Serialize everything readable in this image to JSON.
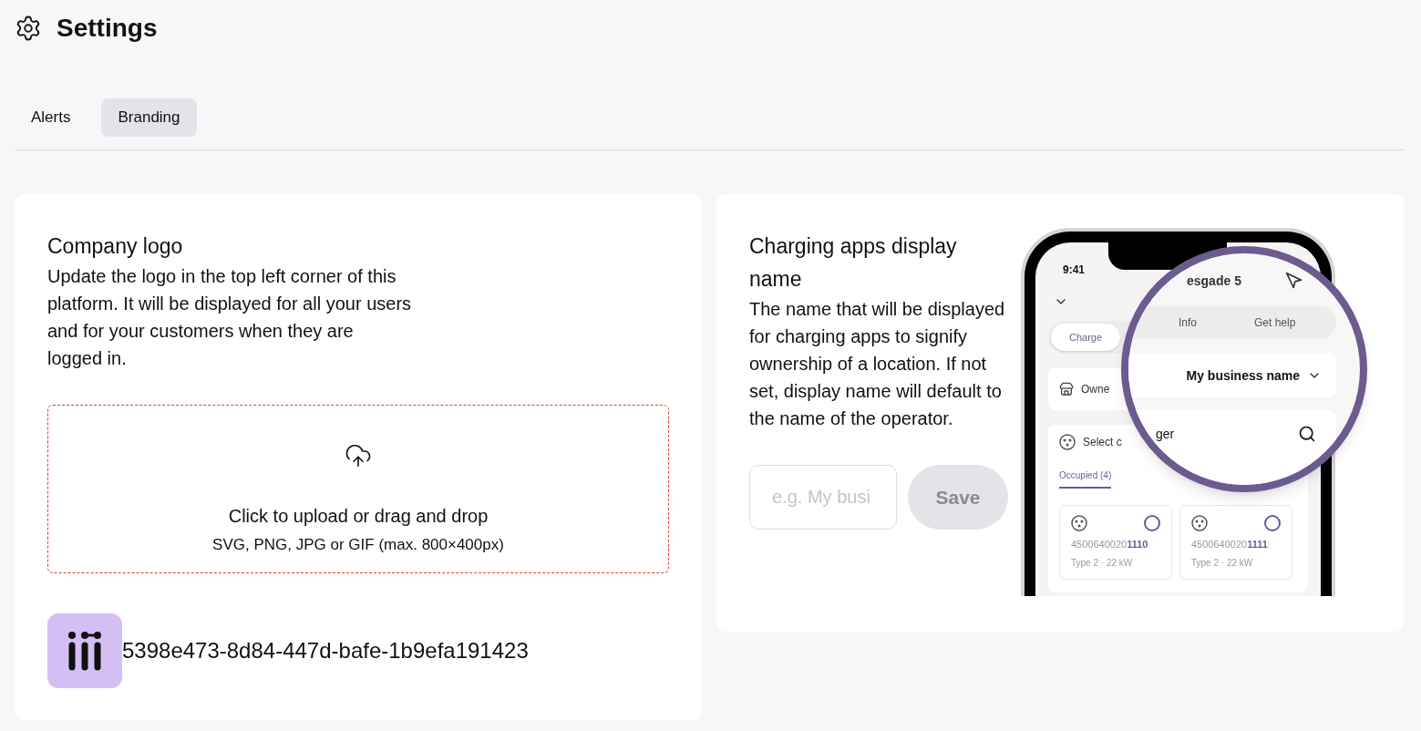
{
  "header": {
    "title": "Settings"
  },
  "tabs": [
    {
      "label": "Alerts",
      "selected": false
    },
    {
      "label": "Branding",
      "selected": true
    }
  ],
  "logo_card": {
    "title": "Company logo",
    "description": "Update the logo in the top left corner of this platform. It will be displayed for all your users and for your customers when they are logged in.",
    "upload": {
      "title": "Click to upload or drag and drop",
      "hint": "SVG, PNG, JPG or GIF (max. 800×400px)"
    },
    "file_name": "5398e473-8d84-447d-bafe-1b9efa191423"
  },
  "display_name_card": {
    "title": "Charging apps display name",
    "description": "The name that will be displayed for charging apps to signify ownership of a location. If not set, display name will default to the name of the operator.",
    "input": {
      "placeholder": "e.g. My busi"
    },
    "save_button": {
      "label": "Save",
      "disabled": true
    }
  },
  "phone_preview": {
    "time": "9:41",
    "location": "esgade 5",
    "tabs": [
      {
        "label": "Charge",
        "selected": true
      },
      {
        "label": "Info",
        "selected": false
      },
      {
        "label": "Get help",
        "selected": false
      }
    ],
    "owner_label": "Owne",
    "owner_value": "My business name",
    "select_label": "Select c",
    "search_text": "ger",
    "filter": "Occupied (4)",
    "chargers": [
      {
        "id": "4500640020**1110**",
        "type": "Type 2 · 22 kW",
        "selected": false
      },
      {
        "id": "4500640020**1111**",
        "type": "Type 2 · 22 kW",
        "selected": false
      }
    ]
  }
}
